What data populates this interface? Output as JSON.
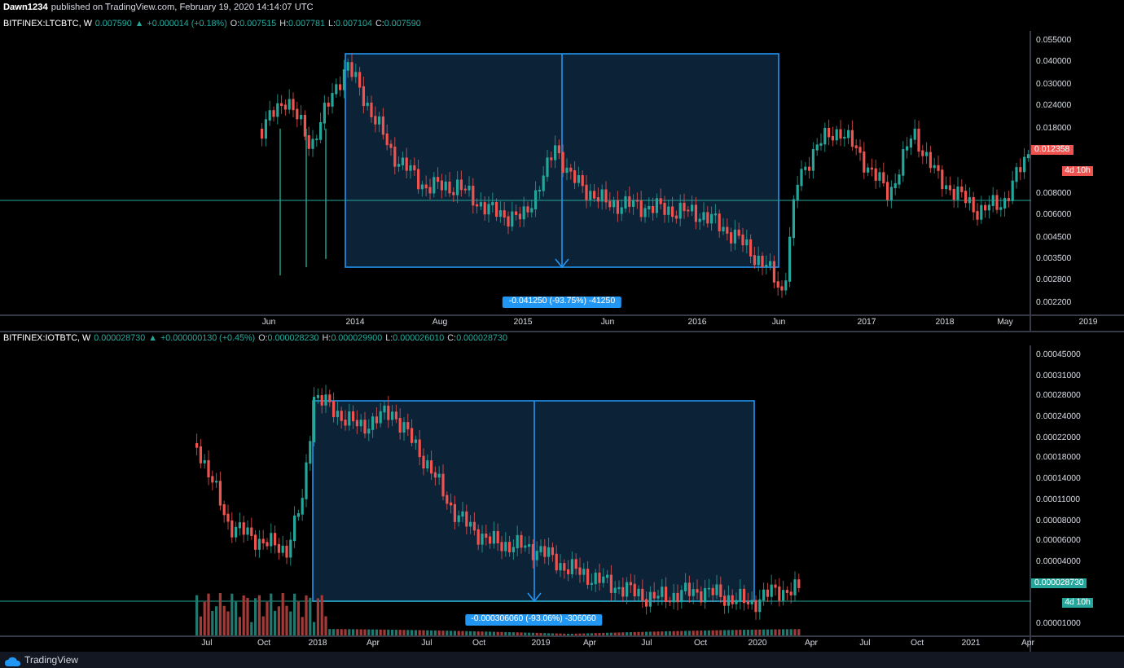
{
  "header": {
    "author": "Dawn1234",
    "published": "published on TradingView.com, February 19, 2020 14:14:07 UTC"
  },
  "panes": [
    {
      "legend": {
        "symbol": "BITFINEX:LTCBTC, W",
        "price": "0.007590",
        "arrow": "▲",
        "change": "+0.000014 (+0.18%)",
        "ohlc": [
          {
            "key": "O:",
            "value": "0.007515"
          },
          {
            "key": "H:",
            "value": "0.007781"
          },
          {
            "key": "L:",
            "value": "0.007104"
          },
          {
            "key": "C:",
            "value": "0.007590"
          }
        ]
      },
      "measure": "-0.041250 (-93.75%) -41250",
      "y_axis": [
        {
          "kind": "tick",
          "text": "0.055000"
        },
        {
          "kind": "tick",
          "text": "0.040000"
        },
        {
          "kind": "tick",
          "text": "0.030000"
        },
        {
          "kind": "tick",
          "text": "0.024000"
        },
        {
          "kind": "tick",
          "text": "0.018000"
        },
        {
          "kind": "price",
          "text": "0.012358"
        },
        {
          "kind": "countdown",
          "text": "4d 10h"
        },
        {
          "kind": "tick",
          "text": "0.008000"
        },
        {
          "kind": "tick",
          "text": "0.006000"
        },
        {
          "kind": "tick",
          "text": "0.004500"
        },
        {
          "kind": "tick",
          "text": "0.003500"
        },
        {
          "kind": "tick",
          "text": "0.002800"
        },
        {
          "kind": "tick",
          "text": "0.002200"
        }
      ],
      "x_axis": [
        "Jun",
        "2014",
        "Aug",
        "2015",
        "Jun",
        "2016",
        "Jun",
        "2017",
        "2018",
        "May",
        "2019"
      ]
    },
    {
      "legend": {
        "symbol": "BITFINEX:IOTBTC, W",
        "price": "0.000028730",
        "arrow": "▲",
        "change": "+0.000000130 (+0.45%)",
        "ohlc": [
          {
            "key": "O:",
            "value": "0.000028230"
          },
          {
            "key": "H:",
            "value": "0.000029900"
          },
          {
            "key": "L:",
            "value": "0.000026010"
          },
          {
            "key": "C:",
            "value": "0.000028730"
          }
        ]
      },
      "measure": "-0.000306060 (-93.06%) -306060",
      "y_axis": [
        {
          "kind": "tick",
          "text": "0.00045000"
        },
        {
          "kind": "tick",
          "text": "0.00031000"
        },
        {
          "kind": "tick",
          "text": "0.00028000"
        },
        {
          "kind": "tick",
          "text": "0.00024000"
        },
        {
          "kind": "tick",
          "text": "0.00022000"
        },
        {
          "kind": "tick",
          "text": "0.00018000"
        },
        {
          "kind": "tick",
          "text": "0.00014000"
        },
        {
          "kind": "tick",
          "text": "0.00011000"
        },
        {
          "kind": "tick",
          "text": "0.00008000"
        },
        {
          "kind": "tick",
          "text": "0.00006000"
        },
        {
          "kind": "tick",
          "text": "0.00004000"
        },
        {
          "kind": "price",
          "text": "0.000028730"
        },
        {
          "kind": "countdown",
          "text": "4d 10h"
        },
        {
          "kind": "tick",
          "text": "0.00001000"
        }
      ],
      "x_axis": [
        "Jul",
        "Oct",
        "2018",
        "Apr",
        "Jul",
        "Oct",
        "2019",
        "Apr",
        "Jul",
        "Oct",
        "2020",
        "Apr",
        "Jul",
        "Oct",
        "2021",
        "Apr"
      ]
    }
  ],
  "footer": {
    "brand": "TradingView"
  }
}
